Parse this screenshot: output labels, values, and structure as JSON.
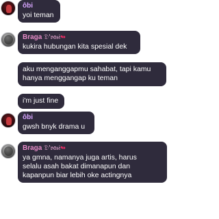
{
  "messages": [
    {
      "sender": "ôbi",
      "text": "yoi teman"
    },
    {
      "sender": "Braga",
      "sender_tag": "𝔇'𝔳𝔞𝔰𝔦",
      "sender_mark": "↬",
      "text": "kukira hubungan kita spesial dek"
    },
    {
      "text": "aku menganggapmu sahabat, tapi kamu\nhanya menggangap ku teman"
    },
    {
      "text": "i'm just fine"
    },
    {
      "sender": "ôbi",
      "text": "gwsh bnyk drama u"
    },
    {
      "sender": "Braga",
      "sender_tag": "𝔇'𝔳𝔞𝔰𝔦",
      "sender_mark": "↬",
      "text": "ya gmna, namanya juga artis, harus\nselalu asah bakat dimanapun dan\nkapanpun biar lebih oke actingnya"
    }
  ],
  "colors": {
    "bubble_bg": "#2f2b3c",
    "obi_name": "#d8a6ff",
    "braga_name": "#e88dc9"
  }
}
